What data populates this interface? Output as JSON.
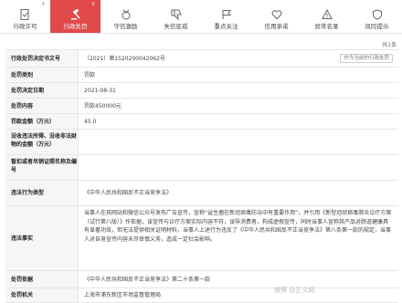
{
  "tabs": [
    {
      "label": "行政许可",
      "count": "4",
      "icon": "doc-check-icon"
    },
    {
      "label": "行政处罚",
      "count": "6",
      "icon": "gavel-icon",
      "active": true
    },
    {
      "label": "守信激励",
      "count": "",
      "icon": "medal-icon"
    },
    {
      "label": "失信惩戒",
      "count": "",
      "icon": "thumbs-down-icon"
    },
    {
      "label": "重点关注",
      "count": "",
      "icon": "flag-icon"
    },
    {
      "label": "信用承诺",
      "count": "",
      "icon": "heart-icon"
    },
    {
      "label": "异常名录",
      "count": "",
      "icon": "warning-icon"
    },
    {
      "label": "风险提示",
      "count": "",
      "icon": "shield-icon"
    }
  ],
  "total": "共1条",
  "rows": [
    {
      "label": "行政处罚决定书文号",
      "value": "（2021）第1520200042062号",
      "button": "作为当前的行政处罚"
    },
    {
      "label": "处罚类别",
      "value": "罚款"
    },
    {
      "label": "处罚决定日期",
      "value": "2021-08-31"
    },
    {
      "label": "处罚内容",
      "value": "罚款450000元"
    },
    {
      "label": "罚款金额（万元）",
      "value": "45.0"
    },
    {
      "label": "没收违法所得、没收非法财物的金额（万元）",
      "value": ""
    },
    {
      "label": "暂扣或者吊销证照名称及编号",
      "value": ""
    },
    {
      "label": "违法行为类型",
      "value": "《中华人民共和国反不正当竞争法》"
    },
    {
      "label": "违法事实",
      "value": "当事人在其网站和微信公众号发布广告宣传，宣称“益生菌在新冠病毒防治中有重要作用”，并引用《新型冠状病毒肺炎诊疗方案（试行第八版）》作依据，该宣传与诊疗方案实际内容不符，误导消费者，构成虚假宣传，同时当事人宣称其产品对肠道健康具有显著功效，但无法提供相关证明材料，当事人上述行为违反了《中华人民共和国反不正当竞争法》第八条第一款的规定，当事人对自身宣传内容未尽审慎义务，造成一定社会影响。"
    },
    {
      "label": "处罚依据",
      "value": "《中华人民共和国反不正当竞争法》第二十条第一款"
    },
    {
      "label": "处罚机关",
      "value": "上海市浦东新区市场监督管理局"
    }
  ],
  "watermark": "微博 @正义网"
}
